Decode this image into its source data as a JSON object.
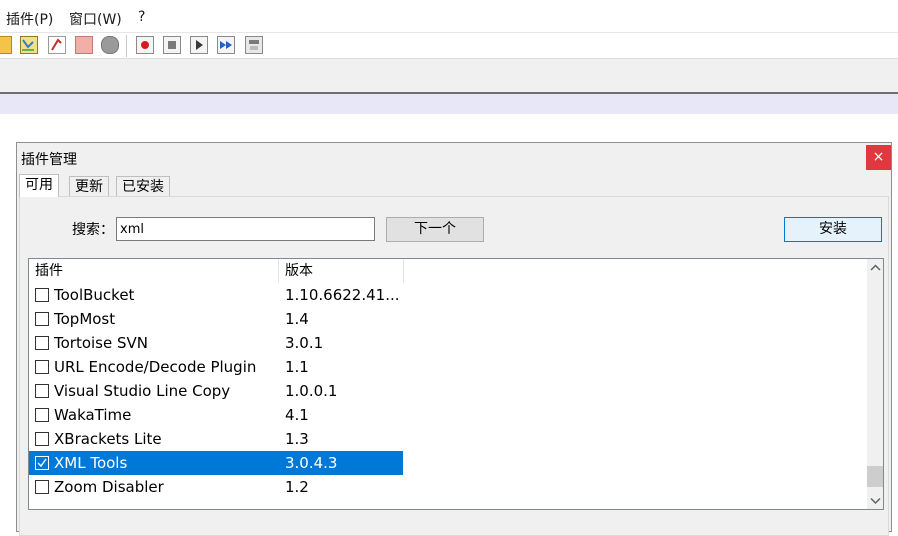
{
  "menu": {
    "plugins": "插件(P)",
    "window": "窗口(W)",
    "help": "?"
  },
  "toolbar": {
    "icons": [
      "edit-tools-icon",
      "map-icon",
      "function-list-icon",
      "folder-icon",
      "cloud-icon",
      "record-macro-icon",
      "stop-icon",
      "play-icon",
      "run-multiple-icon",
      "save-macro-icon"
    ]
  },
  "dialog": {
    "title": "插件管理",
    "close_glyph": "×",
    "tabs": [
      {
        "label": "可用",
        "active": true
      },
      {
        "label": "更新",
        "active": false
      },
      {
        "label": "已安装",
        "active": false
      }
    ],
    "search": {
      "label": "搜索：",
      "value": "xml"
    },
    "next_button": "下一个",
    "install_button": "安装",
    "list": {
      "columns": [
        "插件",
        "版本"
      ],
      "rows": [
        {
          "name": "ToolBucket",
          "version": "1.10.6622.41...",
          "checked": false,
          "selected": false
        },
        {
          "name": "TopMost",
          "version": "1.4",
          "checked": false,
          "selected": false
        },
        {
          "name": "Tortoise SVN",
          "version": "3.0.1",
          "checked": false,
          "selected": false
        },
        {
          "name": "URL Encode/Decode Plugin",
          "version": "1.1",
          "checked": false,
          "selected": false
        },
        {
          "name": "Visual Studio Line Copy",
          "version": "1.0.0.1",
          "checked": false,
          "selected": false
        },
        {
          "name": "WakaTime",
          "version": "4.1",
          "checked": false,
          "selected": false
        },
        {
          "name": "XBrackets Lite",
          "version": "1.3",
          "checked": false,
          "selected": false
        },
        {
          "name": "XML Tools",
          "version": "3.0.4.3",
          "checked": true,
          "selected": true
        },
        {
          "name": "Zoom Disabler",
          "version": "1.2",
          "checked": false,
          "selected": false
        }
      ]
    }
  },
  "colors": {
    "selection": "#0078d7",
    "close_button": "#e0383c"
  }
}
